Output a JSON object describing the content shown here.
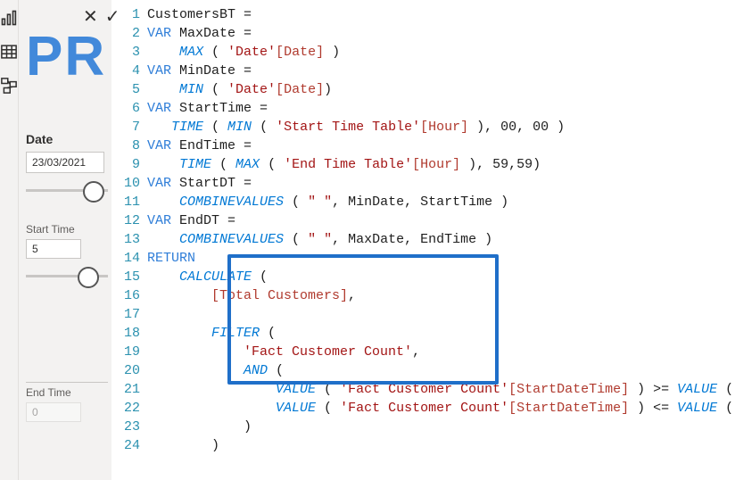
{
  "rail": {
    "report_tip": "Report view",
    "data_tip": "Data view",
    "model_tip": "Model view"
  },
  "bgword": "PR",
  "left": {
    "date_label": "Date",
    "date_value": "23/03/2021",
    "start_label": "Start Time",
    "start_value": "5",
    "end_label": "End Time",
    "end_value": "0"
  },
  "formula_buttons": {
    "cancel": "✕",
    "commit": "✓"
  },
  "code": {
    "lines": [
      [
        [
          "id",
          "CustomersBT ="
        ]
      ],
      [
        [
          "kw",
          "VAR "
        ],
        [
          "id",
          "MaxDate ="
        ]
      ],
      [
        [
          "id",
          "    "
        ],
        [
          "fn",
          "MAX"
        ],
        [
          "id",
          " ( "
        ],
        [
          "str",
          "'Date'"
        ],
        [
          "col",
          "[Date]"
        ],
        [
          "id",
          " )"
        ]
      ],
      [
        [
          "kw",
          "VAR "
        ],
        [
          "id",
          "MinDate ="
        ]
      ],
      [
        [
          "id",
          "    "
        ],
        [
          "fn",
          "MIN"
        ],
        [
          "id",
          " ( "
        ],
        [
          "str",
          "'Date'"
        ],
        [
          "col",
          "[Date]"
        ],
        [
          "id",
          ")"
        ]
      ],
      [
        [
          "kw",
          "VAR "
        ],
        [
          "id",
          "StartTime ="
        ]
      ],
      [
        [
          "id",
          "   "
        ],
        [
          "fn",
          "TIME"
        ],
        [
          "id",
          " ( "
        ],
        [
          "fn",
          "MIN"
        ],
        [
          "id",
          " ( "
        ],
        [
          "str",
          "'Start Time Table'"
        ],
        [
          "col",
          "[Hour]"
        ],
        [
          "id",
          " ), 00, 00 )"
        ]
      ],
      [
        [
          "kw",
          "VAR "
        ],
        [
          "id",
          "EndTime ="
        ]
      ],
      [
        [
          "id",
          "    "
        ],
        [
          "fn",
          "TIME"
        ],
        [
          "id",
          " ( "
        ],
        [
          "fn",
          "MAX"
        ],
        [
          "id",
          " ( "
        ],
        [
          "str",
          "'End Time Table'"
        ],
        [
          "col",
          "[Hour]"
        ],
        [
          "id",
          " ), 59,59)"
        ]
      ],
      [
        [
          "kw",
          "VAR "
        ],
        [
          "id",
          "StartDT ="
        ]
      ],
      [
        [
          "id",
          "    "
        ],
        [
          "fn",
          "COMBINEVALUES"
        ],
        [
          "id",
          " ( "
        ],
        [
          "str",
          "\" \""
        ],
        [
          "id",
          ", MinDate, StartTime )"
        ]
      ],
      [
        [
          "kw",
          "VAR "
        ],
        [
          "id",
          "EndDT ="
        ]
      ],
      [
        [
          "id",
          "    "
        ],
        [
          "fn",
          "COMBINEVALUES"
        ],
        [
          "id",
          " ( "
        ],
        [
          "str",
          "\" \""
        ],
        [
          "id",
          ", MaxDate, EndTime )"
        ]
      ],
      [
        [
          "kw",
          "RETURN"
        ]
      ],
      [
        [
          "id",
          "    "
        ],
        [
          "fn",
          "CALCULATE"
        ],
        [
          "id",
          " ("
        ]
      ],
      [
        [
          "id",
          "        "
        ],
        [
          "col",
          "[Total Customers]"
        ],
        [
          "id",
          ","
        ]
      ],
      [
        [
          "id",
          ""
        ]
      ],
      [
        [
          "id",
          "        "
        ],
        [
          "fn",
          "FILTER"
        ],
        [
          "id",
          " ("
        ]
      ],
      [
        [
          "id",
          "            "
        ],
        [
          "str",
          "'Fact Customer Count'"
        ],
        [
          "id",
          ","
        ]
      ],
      [
        [
          "id",
          "            "
        ],
        [
          "fn",
          "AND"
        ],
        [
          "id",
          " ("
        ]
      ],
      [
        [
          "id",
          "                "
        ],
        [
          "fn",
          "VALUE"
        ],
        [
          "id",
          " ( "
        ],
        [
          "str",
          "'Fact Customer Count'"
        ],
        [
          "col",
          "[StartDateTime]"
        ],
        [
          "id",
          " ) >= "
        ],
        [
          "fn",
          "VALUE"
        ],
        [
          "id",
          " ( StartDT ),"
        ]
      ],
      [
        [
          "id",
          "                "
        ],
        [
          "fn",
          "VALUE"
        ],
        [
          "id",
          " ( "
        ],
        [
          "str",
          "'Fact Customer Count'"
        ],
        [
          "col",
          "[StartDateTime]"
        ],
        [
          "id",
          " ) <= "
        ],
        [
          "fn",
          "VALUE"
        ],
        [
          "id",
          " ( EndDT )"
        ]
      ],
      [
        [
          "id",
          "            )"
        ]
      ],
      [
        [
          "id",
          "        )"
        ]
      ]
    ]
  }
}
